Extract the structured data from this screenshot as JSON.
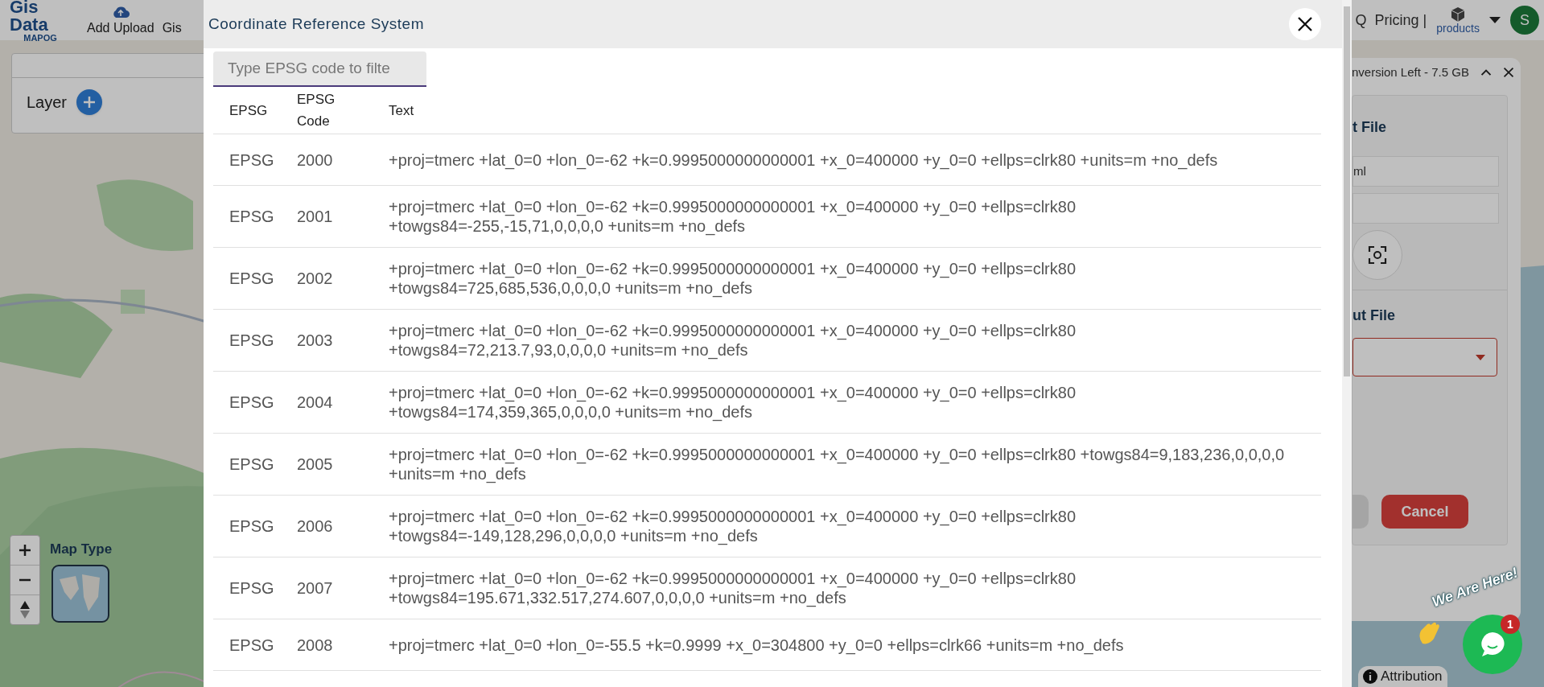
{
  "navbar": {
    "logo_title": "Gis Data",
    "logo_subtitle": "MAPOG",
    "items": [
      "Add Upload",
      "Gis"
    ],
    "right_text": "Q  Pricing |",
    "products": "products",
    "avatar": "S"
  },
  "layer_panel": {
    "title": "Layer"
  },
  "map_controls": {
    "map_type_label": "Map Type"
  },
  "conversion_panel": {
    "header": "nversion Left - 7.5 GB",
    "input_heading": "t File",
    "input_value": "ml",
    "output_heading": "ut File",
    "cancel": "Cancel"
  },
  "chat_widget": {
    "tagline": "We Are Here!",
    "badge": "1"
  },
  "attribution": "Attribution",
  "dialog": {
    "title": "Coordinate Reference System",
    "filter": {
      "placeholder": "Type EPSG code to filte"
    },
    "table": {
      "columns": [
        "EPSG",
        "EPSG Code",
        "Text"
      ],
      "rows": [
        {
          "authority": "EPSG",
          "code": "2000",
          "text": "+proj=tmerc +lat_0=0 +lon_0=-62 +k=0.9995000000000001 +x_0=400000 +y_0=0 +ellps=clrk80 +units=m +no_defs"
        },
        {
          "authority": "EPSG",
          "code": "2001",
          "text": "+proj=tmerc +lat_0=0 +lon_0=-62 +k=0.9995000000000001 +x_0=400000 +y_0=0 +ellps=clrk80 +towgs84=-255,-15,71,0,0,0,0 +units=m +no_defs"
        },
        {
          "authority": "EPSG",
          "code": "2002",
          "text": "+proj=tmerc +lat_0=0 +lon_0=-62 +k=0.9995000000000001 +x_0=400000 +y_0=0 +ellps=clrk80 +towgs84=725,685,536,0,0,0,0 +units=m +no_defs"
        },
        {
          "authority": "EPSG",
          "code": "2003",
          "text": "+proj=tmerc +lat_0=0 +lon_0=-62 +k=0.9995000000000001 +x_0=400000 +y_0=0 +ellps=clrk80 +towgs84=72,213.7,93,0,0,0,0 +units=m +no_defs"
        },
        {
          "authority": "EPSG",
          "code": "2004",
          "text": "+proj=tmerc +lat_0=0 +lon_0=-62 +k=0.9995000000000001 +x_0=400000 +y_0=0 +ellps=clrk80 +towgs84=174,359,365,0,0,0,0 +units=m +no_defs"
        },
        {
          "authority": "EPSG",
          "code": "2005",
          "text": "+proj=tmerc +lat_0=0 +lon_0=-62 +k=0.9995000000000001 +x_0=400000 +y_0=0 +ellps=clrk80 +towgs84=9,183,236,0,0,0,0 +units=m +no_defs"
        },
        {
          "authority": "EPSG",
          "code": "2006",
          "text": "+proj=tmerc +lat_0=0 +lon_0=-62 +k=0.9995000000000001 +x_0=400000 +y_0=0 +ellps=clrk80 +towgs84=-149,128,296,0,0,0,0 +units=m +no_defs"
        },
        {
          "authority": "EPSG",
          "code": "2007",
          "text": "+proj=tmerc +lat_0=0 +lon_0=-62 +k=0.9995000000000001 +x_0=400000 +y_0=0 +ellps=clrk80 +towgs84=195.671,332.517,274.607,0,0,0,0 +units=m +no_defs"
        },
        {
          "authority": "EPSG",
          "code": "2008",
          "text": "+proj=tmerc +lat_0=0 +lon_0=-55.5 +k=0.9999 +x_0=304800 +y_0=0 +ellps=clrk66 +units=m +no_defs"
        }
      ]
    }
  }
}
